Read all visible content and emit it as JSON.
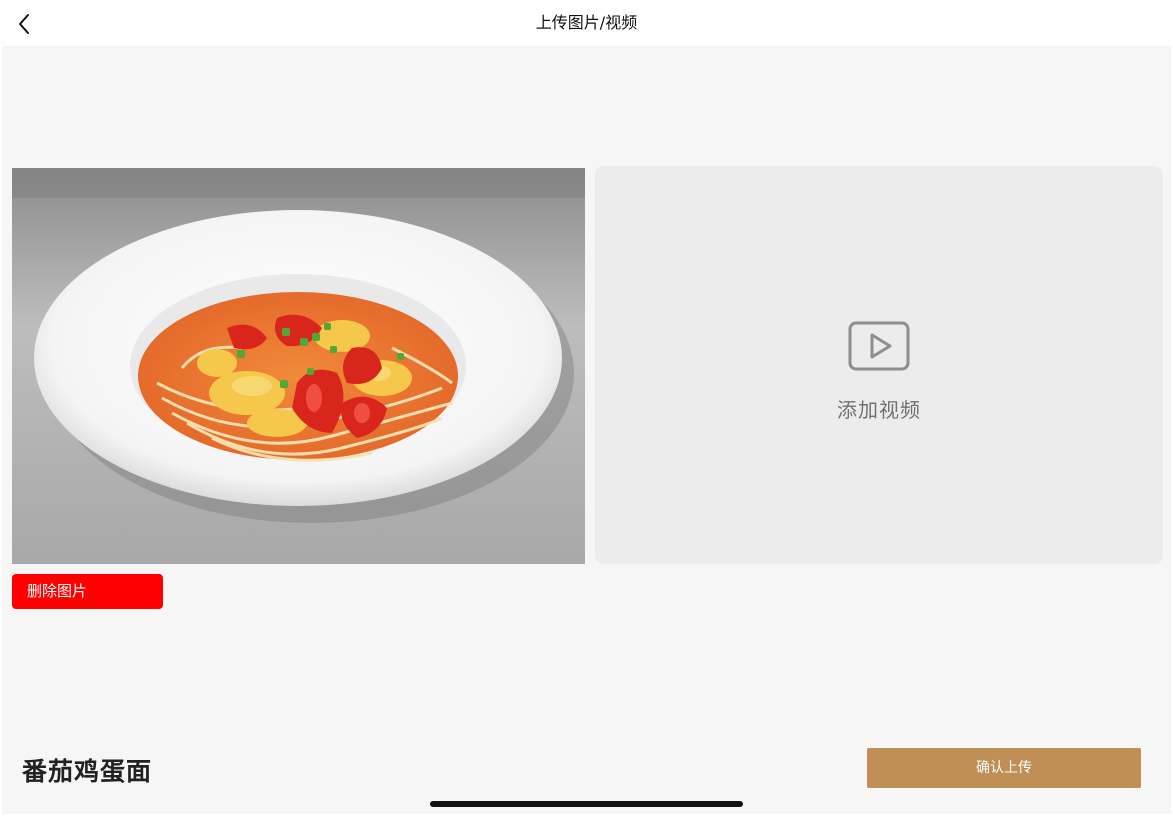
{
  "header": {
    "title": "上传图片/视频",
    "back_icon": "chevron-left-icon"
  },
  "photo": {
    "delete_label": "删除图片",
    "delete_color": "#ff0000"
  },
  "video": {
    "add_label": "添加视频",
    "icon": "play-video-icon"
  },
  "footer": {
    "dish_name": "番茄鸡蛋面",
    "confirm_label": "确认上传",
    "confirm_color": "#c08f55"
  }
}
